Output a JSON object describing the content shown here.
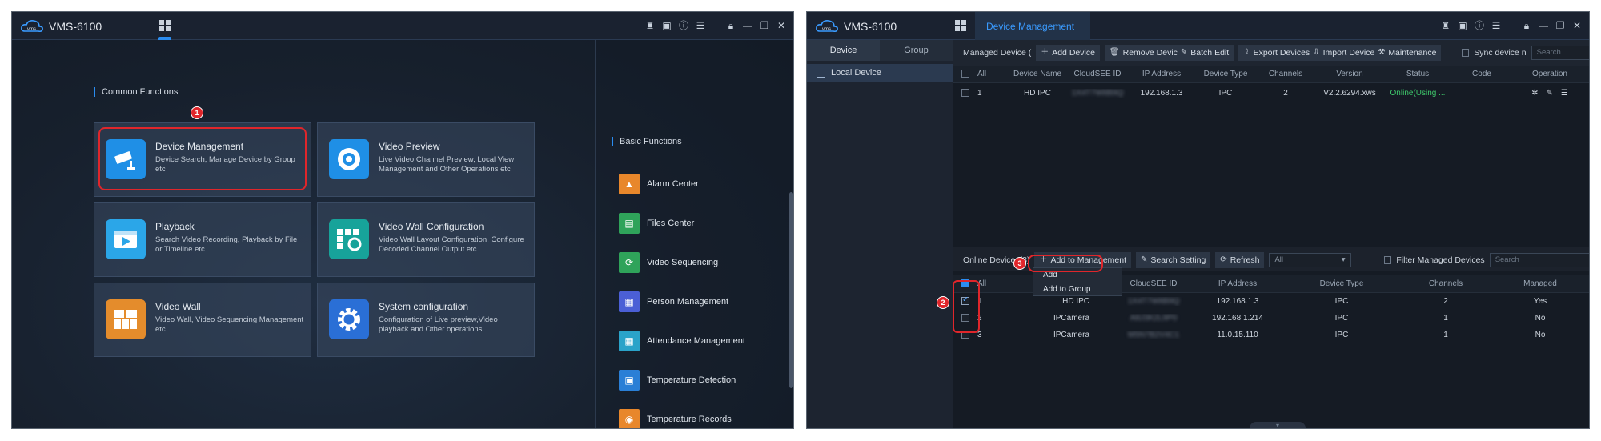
{
  "left": {
    "app_title": "VMS-6100",
    "logo_text": "vms",
    "common_functions_label": "Common Functions",
    "cards": [
      {
        "title": "Device Management",
        "desc": "Device Search, Manage Device by Group etc",
        "icon": "cctv-camera-icon",
        "color": "#1f8fe6"
      },
      {
        "title": "Video Preview",
        "desc": "Live Video Channel Preview, Local View Management and Other Operations etc",
        "icon": "eye-icon",
        "color": "#1f8fe6"
      },
      {
        "title": "Playback",
        "desc": "Search Video Recording, Playback by File or Timeline etc",
        "icon": "film-play-icon",
        "color": "#2ba6e8"
      },
      {
        "title": "Video Wall Configuration",
        "desc": "Video Wall Layout Configuration, Configure Decoded Channel Output etc",
        "icon": "wall-gear-icon",
        "color": "#17a39a"
      },
      {
        "title": "Video Wall",
        "desc": "Video Wall, Video Sequencing Management etc",
        "icon": "video-wall-icon",
        "color": "#e48c2c"
      },
      {
        "title": "System configuration",
        "desc": "Configuration of Live preview,Video playback and Other operations",
        "icon": "gear-icon",
        "color": "#2a6fd6"
      }
    ],
    "basic_functions_label": "Basic Functions",
    "basic_functions": [
      {
        "label": "Alarm Center",
        "icon": "alarm-light-icon",
        "color": "#e8872b"
      },
      {
        "label": "Files Center",
        "icon": "files-icon",
        "color": "#2fa35a"
      },
      {
        "label": "Video Sequencing",
        "icon": "sequence-icon",
        "color": "#2fa35a"
      },
      {
        "label": "Person Management",
        "icon": "person-icon",
        "color": "#4b5fd6"
      },
      {
        "label": "Attendance Management",
        "icon": "calendar-icon",
        "color": "#2aa3c9"
      },
      {
        "label": "Temperature Detection",
        "icon": "temperature-person-icon",
        "color": "#2a7fd6"
      },
      {
        "label": "Temperature Records",
        "icon": "temperature-record-icon",
        "color": "#e8872b"
      }
    ],
    "step_badge": "1"
  },
  "right": {
    "app_title": "VMS-6100",
    "logo_text": "vms",
    "active_tab": "Device Management",
    "side_tabs": [
      "Device",
      "Group"
    ],
    "side_item": "Local Device",
    "toolbar": {
      "managed_label": "Managed Device (",
      "add_device": "Add Device",
      "remove_device": "Remove Devic",
      "batch_edit": "Batch Edit",
      "export_devices": "Export Devices",
      "import_device": "Import Device",
      "maintenance": "Maintenance",
      "sync_label": "Sync device n",
      "search_placeholder": "Search"
    },
    "managed_headers": [
      "All",
      "Device Name",
      "CloudSEE ID",
      "IP Address",
      "Device Type",
      "Channels",
      "Version",
      "Status",
      "Code",
      "Operation"
    ],
    "managed_rows": [
      {
        "num": "1",
        "name": "HD IPC",
        "cloud_id": "1X4T7W8B9Q",
        "ip": "192.168.1.3",
        "type": "IPC",
        "channels": "2",
        "version": "V2.2.6294.xws",
        "status": "Online(Using ..."
      }
    ],
    "online_toolbar": {
      "online_label": "Online Devices(3)",
      "add_to_management": "Add to Management",
      "search_setting": "Search Setting",
      "refresh": "Refresh",
      "filter_select": "All",
      "filter_label": "Filter Managed Devices",
      "search_placeholder": "Search"
    },
    "popup_menu": [
      "Add",
      "Add to Group"
    ],
    "online_headers": [
      "All",
      "CloudSEE ID",
      "IP Address",
      "Device Type",
      "Channels",
      "Managed"
    ],
    "online_rows": [
      {
        "num": "1",
        "name": "HD IPC",
        "cloud_id": "1X4T7W8B9Q",
        "ip": "192.168.1.3",
        "type": "IPC",
        "channels": "2",
        "managed": "Yes",
        "checked": true
      },
      {
        "num": "2",
        "name": "IPCamera",
        "cloud_id": "A8J3K2L9P0",
        "ip": "192.168.1.214",
        "type": "IPC",
        "channels": "1",
        "managed": "No",
        "checked": false
      },
      {
        "num": "3",
        "name": "IPCamera",
        "cloud_id": "M5N7B2V4C1",
        "ip": "11.0.15.110",
        "type": "IPC",
        "channels": "1",
        "managed": "No",
        "checked": false
      }
    ],
    "step_badges": [
      "2",
      "3"
    ]
  },
  "colors": {
    "accent": "#2a8cf0",
    "highlight": "#e0262b",
    "online": "#3ec86b"
  }
}
